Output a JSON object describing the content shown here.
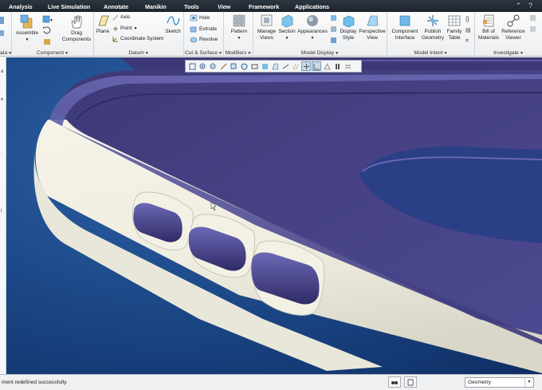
{
  "menu": {
    "items": [
      "Analysis",
      "Live Simulation",
      "Annotate",
      "Manikin",
      "Tools",
      "View",
      "Framework",
      "Applications"
    ]
  },
  "ribbon": {
    "groups": {
      "data": "ata",
      "component": "Component",
      "datum": "Datum",
      "cut_surface": "Cut & Surface",
      "modifiers": "Modifiers",
      "model_display": "Model Display",
      "model_intent": "Model Intent",
      "investigate": "Investigate"
    },
    "buttons": {
      "assemble": "Assemble",
      "drag_1": "Drag",
      "drag_2": "Components",
      "plane": "Plane",
      "axis": "Axis",
      "point": "Point",
      "coordinate_system": "Coordinate System",
      "sketch": "Sketch",
      "hole": "Hole",
      "extrude": "Extrude",
      "revolve": "Revolve",
      "pattern": "Pattern",
      "manage_views_1": "Manage",
      "manage_views_2": "Views",
      "section": "Section",
      "appearances": "Appearances",
      "display_style_1": "Display",
      "display_style_2": "Style",
      "perspective_view_1": "Perspective",
      "perspective_view_2": "View",
      "component_interface_1": "Component",
      "component_interface_2": "Interface",
      "publish_geometry_1": "Publish",
      "publish_geometry_2": "Geometry",
      "family_table_1": "Family",
      "family_table_2": "Table",
      "bill_of_materials_1": "Bill of",
      "bill_of_materials_2": "Materials",
      "reference_viewer_1": "Reference",
      "reference_viewer_2": "Viewer"
    }
  },
  "statusbar": {
    "message": "ment redefined successfully.",
    "filter_value": "Geometry"
  },
  "colors": {
    "menubar": "#1f2830",
    "model_body": "#f1efe2",
    "model_top": "#4f4a8e",
    "background_top": "#2b5ea3",
    "background_bottom": "#0f2f66"
  }
}
